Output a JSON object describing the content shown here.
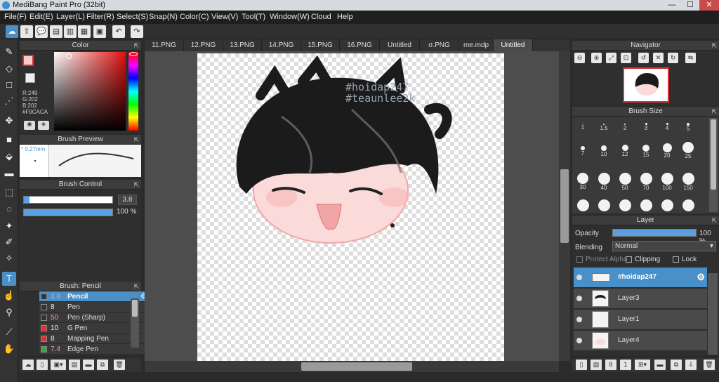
{
  "window": {
    "title": "MediBang Paint Pro (32bit)",
    "minimize": "—",
    "maximize": "☐",
    "close": "✕"
  },
  "menu": [
    "File(F)",
    "Edit(E)",
    "Layer(L)",
    "Filter(R)",
    "Select(S)",
    "Snap(N)",
    "Color(C)",
    "View(V)",
    "Tool(T)",
    "Window(W)",
    "Cloud",
    "Help"
  ],
  "tabs": [
    "11.PNG",
    "12.PNG",
    "13.PNG",
    "14.PNG",
    "15.PNG",
    "16.PNG",
    "Untitled",
    "σ.PNG",
    "me.mdp",
    "Untitled"
  ],
  "color_panel": {
    "title": "Color",
    "r": "R:249",
    "g": "G:202",
    "b": "B:202",
    "hex": "#F9CACA",
    "current": "#f9caca"
  },
  "brush_preview": {
    "title": "Brush Preview",
    "size": "* 0.27mm"
  },
  "brush_control": {
    "title": "Brush Control",
    "size_value": "3.8",
    "opacity_value": "100 %"
  },
  "brush_list": {
    "title": "Brush: Pencil",
    "items": [
      {
        "size": "3.8",
        "name": "Pencil",
        "color": "#333333"
      },
      {
        "size": "8",
        "name": "Pen",
        "color": "#333333"
      },
      {
        "size": "50",
        "name": "Pen (Sharp)",
        "color": "#333333"
      },
      {
        "size": "10",
        "name": "G Pen",
        "color": "#e03030"
      },
      {
        "size": "8",
        "name": "Mapping Pen",
        "color": "#e03030"
      },
      {
        "size": "7.4",
        "name": "Edge Pen",
        "color": "#30b030"
      }
    ]
  },
  "canvas_text": {
    "line1": "#hoidap247",
    "line2": "#teaunlee2k"
  },
  "navigator": {
    "title": "Navigator"
  },
  "brush_size": {
    "title": "Brush Size",
    "sizes": [
      "1",
      "1.5",
      "2",
      "3",
      "4",
      "5",
      "7",
      "10",
      "12",
      "15",
      "20",
      "25",
      "30",
      "40",
      "50",
      "70",
      "100",
      "150",
      "",
      "",
      "",
      "",
      "",
      ""
    ]
  },
  "layer_panel": {
    "title": "Layer",
    "opacity_label": "Opacity",
    "opacity_value": "100 %",
    "opacity": 1.0,
    "blending_label": "Blending",
    "blending_value": "Normal",
    "protect_alpha": "Protect Alpha",
    "clipping": "Clipping",
    "lock": "Lock",
    "layers": [
      "#hoidap247",
      "Layer3",
      "Layer1",
      "Layer4"
    ]
  }
}
